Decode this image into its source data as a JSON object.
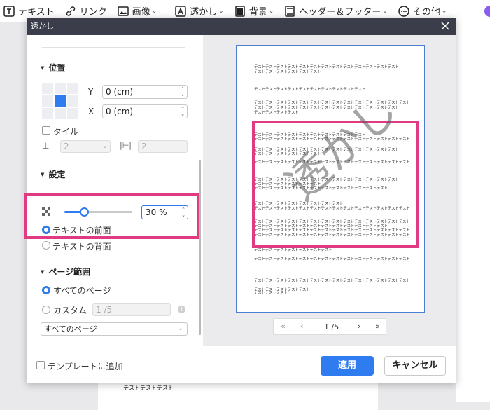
{
  "toolbar": {
    "items": [
      {
        "label": "テキスト",
        "icon": "text-icon"
      },
      {
        "label": "リンク",
        "icon": "link-icon"
      },
      {
        "label": "画像",
        "icon": "image-icon"
      },
      {
        "label": "透かし",
        "icon": "watermark-icon"
      },
      {
        "label": "背景",
        "icon": "background-icon"
      },
      {
        "label": "ヘッダー＆フッター",
        "icon": "header-footer-icon"
      },
      {
        "label": "その他",
        "icon": "more-icon"
      }
    ]
  },
  "dialog": {
    "title": "透かし",
    "position": {
      "heading": "位置",
      "y_label": "Y",
      "y_value": "0 (cm)",
      "x_label": "X",
      "x_value": "0 (cm)",
      "tile_label": "タイル",
      "spacing_1": "2",
      "spacing_2": "2"
    },
    "settings": {
      "heading": "設定",
      "opacity_value": "30 %",
      "opacity_fraction": 0.3,
      "layer_front": "テキストの前面",
      "layer_back": "テキストの背面"
    },
    "page_range": {
      "heading": "ページ範囲",
      "all_pages": "すべてのページ",
      "custom": "カスタム",
      "custom_value": "1 /5",
      "select_value": "すべてのページ"
    },
    "template_label": "テンプレートに追加",
    "apply": "適用",
    "cancel": "キャンセル"
  },
  "preview": {
    "watermark_text": "透かし",
    "lines": [
      "テストテストテストテストテストテストテストテストテストテストテストテストテスト",
      "テストテストテストテストテストテスト",
      "テストテストテストテストテストテストテストテストテストテスト",
      "テストテストテストテストテストテストテストテストテストテストテストテストテストテスト",
      "テストテストテストテストテストテストテストテストテストテストテストテストテスト",
      "テストテストテストテスト",
      "テストテストテストテストテストテストテストテストテストテスト",
      "テストテストテストテストテストテストテストテストテストテストテストテストテストテスト",
      "テストテストテストテストテストテストテストテストテストテストテストテストテスト",
      "テストテストテストテストテストテスト",
      "テストテストテストテストテストテストテストテストテストテストテストテストテストテスト",
      "テストテストテストテストテストテストテストテストテストテストテストテストテスト",
      "テストテストテストテストテストテスト",
      "テストテストテストテストテストテストテストテストテストテストテストテスト",
      "テストテストテストテストテストテストテストテスト",
      "テストテストテストテストテストテストテストテストテストテストテストテストテストテスト",
      "テストテストテストテストテストテストテストテストテストテストテストテストテストテスト",
      "テストテストテストテストテストテストテストテストテストテストテストテスト",
      "テストテストテストテストテストテストテストテストテストテストテストテストテストテスト",
      "テストテストテストテストテストテストテストテストテストテストテストテストテストテスト",
      "テストテストテストテストテストテストテスト",
      "テストテストテストテストテストテストテストテストテストテストテストテストテストテスト",
      "テストテストテストテストテストテストテストテストテストテストテストテストテストテスト",
      "テストテストテストテストテスト",
      "テストテストテスト"
    ],
    "pager": {
      "first": "«",
      "prev": "‹",
      "page": "1 /5",
      "next": "›",
      "last": "»"
    }
  },
  "background_doc": {
    "text": "テストテストテスト"
  },
  "colors": {
    "accent": "#2f7bf0",
    "highlight": "#e03a83",
    "titlebar": "#3b3e4a"
  }
}
